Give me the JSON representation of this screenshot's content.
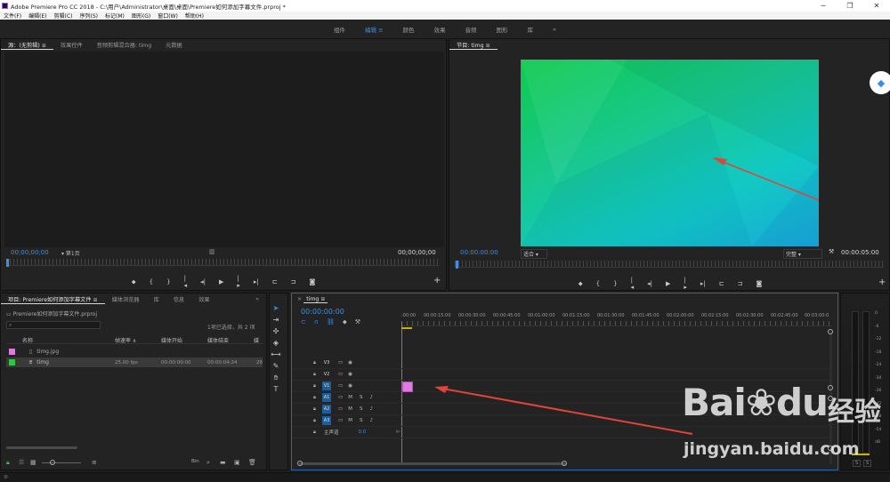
{
  "app": {
    "title": "Adobe Premiere Pro CC 2018 - C:\\用户\\Administrator\\桌面\\桌面\\Premiere如何添加字幕文件.prproj *"
  },
  "window_controls": {
    "minimize": "─",
    "maximize": "❐",
    "close": "✕"
  },
  "menu": [
    "文件(F)",
    "编辑(E)",
    "剪辑(C)",
    "序列(S)",
    "标记(M)",
    "图形(G)",
    "窗口(W)",
    "帮助(H)"
  ],
  "workspaces": {
    "items": [
      "组件",
      "编辑",
      "颜色",
      "效果",
      "音频",
      "图形",
      "库"
    ],
    "active_index": 1,
    "more": "»"
  },
  "source_panel": {
    "tabs": [
      "源：(无剪辑)",
      "效果控件",
      "音频剪辑混合器: timg",
      "元数据"
    ],
    "timecode_left": "00;00;00;00",
    "page_select": "第1页",
    "timecode_right": "00;00;00;00"
  },
  "program_panel": {
    "tab": "节目: timg",
    "timecode_left": "00:00:00:00",
    "fit": "适合",
    "quality": "完整",
    "timecode_right": "00:00:05:00"
  },
  "project_panel": {
    "tabs": [
      "项目: Premiere如何添加字幕文件",
      "媒体浏览器",
      "库",
      "信息",
      "效果"
    ],
    "file": "Premiere如何添加字幕文件.prproj",
    "selection": "1项已选择，共 2 项",
    "columns": [
      "名称",
      "帧速率",
      "媒体开始",
      "媒体结束",
      "媒"
    ],
    "items": [
      {
        "name": "timg.jpg",
        "fps": "",
        "start": "",
        "end": "",
        "color": "#e07ae0"
      },
      {
        "name": "timg",
        "fps": "25.00 fps",
        "start": "00:00:00:00",
        "end": "00:00:04:24",
        "color": "#35c24a"
      }
    ],
    "bottom_label": "Bin"
  },
  "timeline": {
    "tab": "timg",
    "timecode": "00:00:00:00",
    "ruler": [
      ":00:00",
      "00:00:15:00",
      "00:00:30:00",
      "00:00:45:00",
      "00:01:00:00",
      "00:01:15:00",
      "00:01:30:00",
      "00:01:45:00",
      "00:02:00:00",
      "00:02:15:00",
      "00:02:30:00",
      "00:02:45:00",
      "00:03:00:0"
    ],
    "video_tracks": [
      "V3",
      "V2",
      "V1"
    ],
    "audio_tracks": [
      "A1",
      "A2",
      "A3"
    ],
    "track_m": "M",
    "track_s": "S",
    "master_label": "主声道",
    "master_value": "0.0",
    "clip_color": "#e07ae0"
  },
  "audio_meter": {
    "scale": [
      "0",
      "-6",
      "-12",
      "-18",
      "-24",
      "-30",
      "-36",
      "-42",
      "-48",
      "-54",
      "dB"
    ],
    "bottom": [
      "S",
      "S"
    ]
  },
  "watermark": {
    "brand": "Bai",
    "brand_paw": "du",
    "cn": "经验",
    "url": "jingyan.baidu.com"
  }
}
